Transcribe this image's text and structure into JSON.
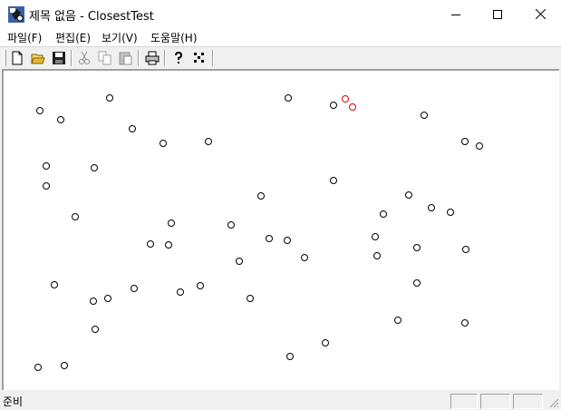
{
  "window": {
    "title": "제목 없음 - ClosestTest",
    "controls": {
      "minimize": "minimize-icon",
      "maximize": "maximize-icon",
      "close": "close-icon"
    }
  },
  "menu": [
    {
      "label": "파일(F)"
    },
    {
      "label": "편집(E)"
    },
    {
      "label": "보기(V)"
    },
    {
      "label": "도움말(H)"
    }
  ],
  "toolbar": {
    "icons": [
      "new-file-icon",
      "open-folder-icon",
      "save-icon",
      "cut-icon",
      "copy-icon",
      "paste-icon",
      "print-icon",
      "help-icon",
      "dots-icon"
    ]
  },
  "status": {
    "text": "준비"
  },
  "colors": {
    "point": "#000000",
    "closest_pair": "#e00000"
  },
  "chart_data": {
    "type": "scatter",
    "series": [
      {
        "values": [
          [
            44,
            122
          ],
          [
            67,
            132
          ],
          [
            121,
            108
          ],
          [
            146,
            142
          ],
          [
            180,
            158
          ],
          [
            230,
            156
          ],
          [
            318,
            108
          ],
          [
            368,
            116
          ],
          [
            468,
            127
          ],
          [
            513,
            156
          ],
          [
            529,
            161
          ],
          [
            51,
            183
          ],
          [
            104,
            185
          ],
          [
            51,
            205
          ],
          [
            368,
            199
          ],
          [
            288,
            216
          ],
          [
            451,
            215
          ],
          [
            476,
            229
          ],
          [
            497,
            234
          ],
          [
            83,
            239
          ],
          [
            423,
            236
          ],
          [
            189,
            246
          ],
          [
            255,
            248
          ],
          [
            414,
            261
          ],
          [
            166,
            269
          ],
          [
            186,
            270
          ],
          [
            297,
            263
          ],
          [
            317,
            265
          ],
          [
            460,
            273
          ],
          [
            514,
            275
          ],
          [
            416,
            282
          ],
          [
            336,
            284
          ],
          [
            264,
            288
          ],
          [
            60,
            314
          ],
          [
            148,
            318
          ],
          [
            221,
            315
          ],
          [
            199,
            322
          ],
          [
            119,
            329
          ],
          [
            103,
            332
          ],
          [
            276,
            329
          ],
          [
            460,
            312
          ],
          [
            439,
            353
          ],
          [
            513,
            356
          ],
          [
            105,
            363
          ],
          [
            359,
            378
          ],
          [
            320,
            393
          ],
          [
            42,
            405
          ],
          [
            71,
            403
          ]
        ]
      }
    ],
    "highlighted_pair": [
      [
        381,
        109
      ],
      [
        389,
        118
      ]
    ]
  }
}
